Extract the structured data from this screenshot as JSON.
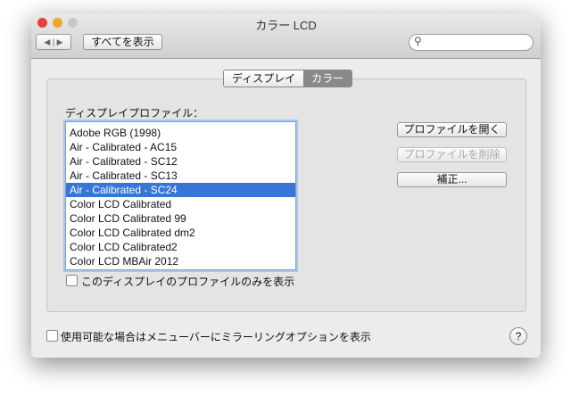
{
  "window": {
    "title": "カラー LCD",
    "show_all": "すべてを表示",
    "search_placeholder": ""
  },
  "tabs": [
    {
      "label": "ディスプレイ",
      "selected": false
    },
    {
      "label": "カラー",
      "selected": true
    }
  ],
  "profiles_label": "ディスプレイプロファイル：",
  "profiles": [
    "Adobe RGB (1998)",
    "Air - Calibrated - AC15",
    "Air - Calibrated - SC12",
    "Air - Calibrated - SC13",
    "Air - Calibrated - SC24",
    "Color LCD Calibrated",
    "Color LCD Calibrated 99",
    "Color LCD Calibrated dm2",
    "Color LCD Calibrated2",
    "Color LCD MBAir 2012"
  ],
  "selected_profile": "Air - Calibrated - SC24",
  "buttons": {
    "open": "プロファイルを開く",
    "delete": "プロファイルを削除",
    "calibrate": "補正..."
  },
  "only_this_display": "このディスプレイのプロファイルのみを表示",
  "mirroring": "使用可能な場合はメニューバーにミラーリングオプションを表示",
  "help": "?",
  "colors": {
    "selection": "#3875d7"
  }
}
